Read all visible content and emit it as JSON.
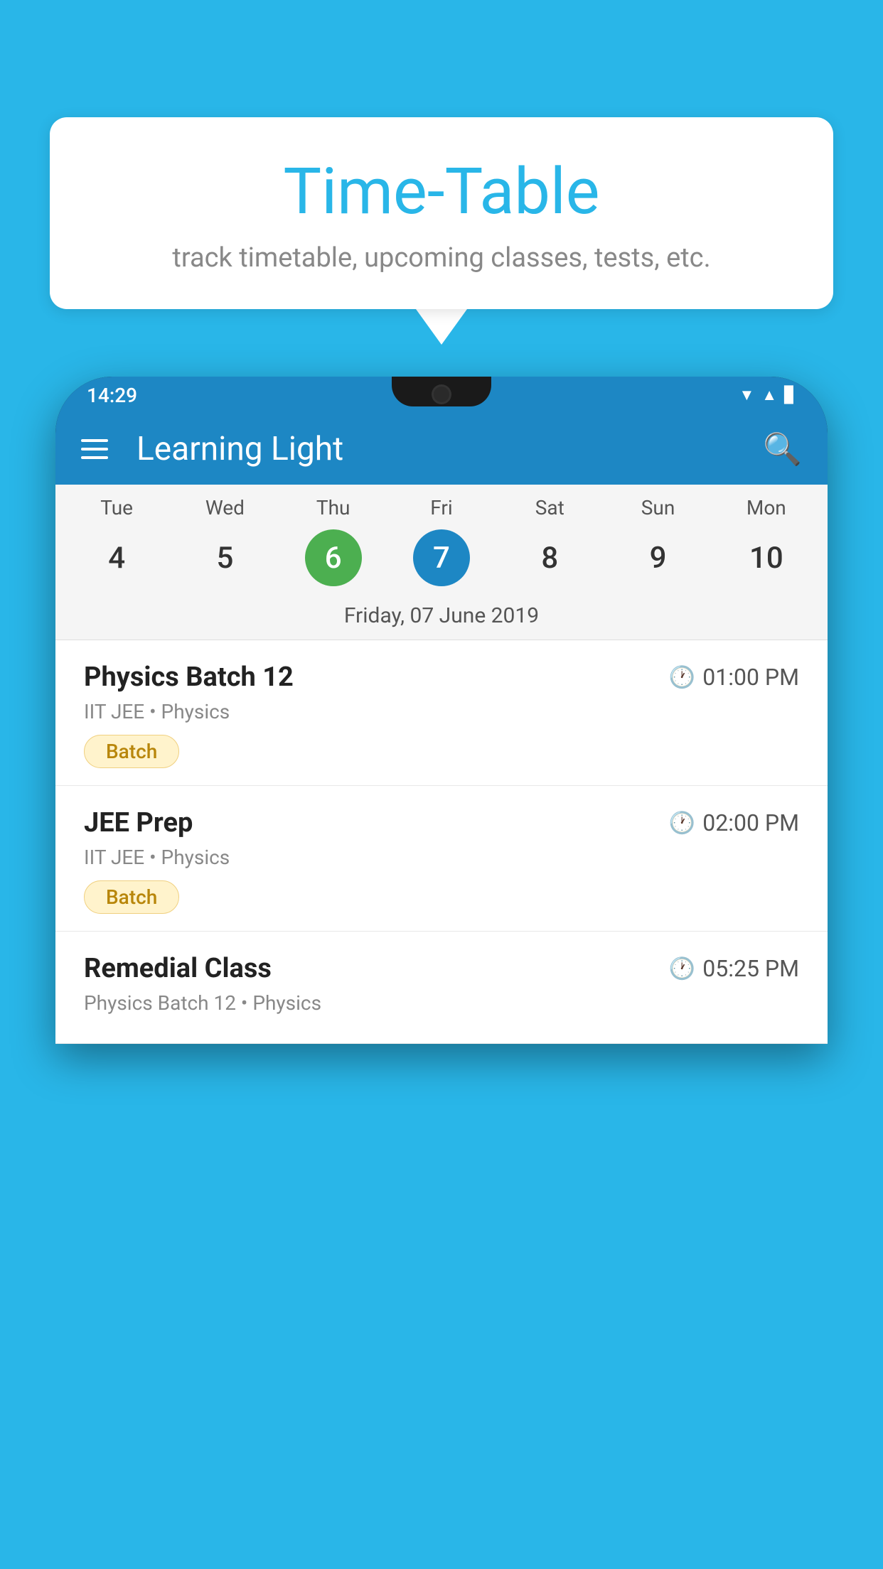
{
  "background_color": "#29B6E8",
  "speech_bubble": {
    "title": "Time-Table",
    "subtitle": "track timetable, upcoming classes, tests, etc."
  },
  "app": {
    "name": "Learning Light"
  },
  "status_bar": {
    "time": "14:29"
  },
  "calendar": {
    "selected_date_label": "Friday, 07 June 2019",
    "days": [
      {
        "name": "Tue",
        "num": "4",
        "state": "normal"
      },
      {
        "name": "Wed",
        "num": "5",
        "state": "normal"
      },
      {
        "name": "Thu",
        "num": "6",
        "state": "today"
      },
      {
        "name": "Fri",
        "num": "7",
        "state": "selected"
      },
      {
        "name": "Sat",
        "num": "8",
        "state": "normal"
      },
      {
        "name": "Sun",
        "num": "9",
        "state": "normal"
      },
      {
        "name": "Mon",
        "num": "10",
        "state": "normal"
      }
    ]
  },
  "schedule": {
    "items": [
      {
        "name": "Physics Batch 12",
        "time": "01:00 PM",
        "detail": "IIT JEE • Physics",
        "badge": "Batch"
      },
      {
        "name": "JEE Prep",
        "time": "02:00 PM",
        "detail": "IIT JEE • Physics",
        "badge": "Batch"
      },
      {
        "name": "Remedial Class",
        "time": "05:25 PM",
        "detail": "Physics Batch 12 • Physics",
        "badge": null
      }
    ]
  }
}
